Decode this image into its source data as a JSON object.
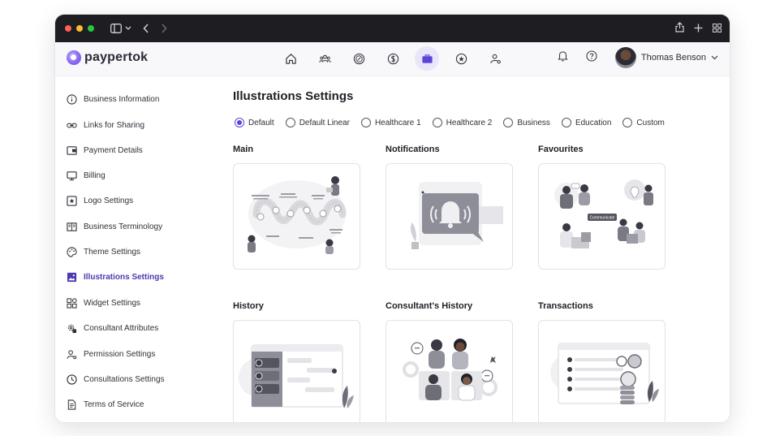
{
  "app": {
    "logo_text": "paypertok",
    "brand_color": "#6b48e0",
    "accent_color": "#5a44d6"
  },
  "titlebar": {
    "icons": [
      "sidebar-icon",
      "chevron-down-icon",
      "back-icon",
      "forward-icon",
      "share-icon",
      "plus-icon",
      "grid-icon"
    ]
  },
  "nav": {
    "items": [
      {
        "name": "home-icon"
      },
      {
        "name": "people-icon"
      },
      {
        "name": "percent-icon"
      },
      {
        "name": "currency-icon"
      },
      {
        "name": "briefcase-icon",
        "active": true
      },
      {
        "name": "star-icon"
      },
      {
        "name": "user-settings-icon"
      }
    ]
  },
  "user": {
    "name": "Thomas Benson"
  },
  "sidebar": {
    "items": [
      {
        "label": "Business Information",
        "icon": "info-icon"
      },
      {
        "label": "Links for Sharing",
        "icon": "link-icon"
      },
      {
        "label": "Payment Details",
        "icon": "wallet-icon"
      },
      {
        "label": "Billing",
        "icon": "monitor-icon"
      },
      {
        "label": "Logo Settings",
        "icon": "star-box-icon"
      },
      {
        "label": "Business Terminology",
        "icon": "book-icon"
      },
      {
        "label": "Theme Settings",
        "icon": "palette-icon"
      },
      {
        "label": "Illustrations Settings",
        "icon": "image-icon",
        "active": true
      },
      {
        "label": "Widget Settings",
        "icon": "widgets-icon"
      },
      {
        "label": "Consultant Attributes",
        "icon": "gear-user-icon"
      },
      {
        "label": "Permission Settings",
        "icon": "user-key-icon"
      },
      {
        "label": "Consultations Settings",
        "icon": "clock-icon"
      },
      {
        "label": "Terms of Service",
        "icon": "document-icon"
      }
    ]
  },
  "main": {
    "title": "Illustrations Settings",
    "options": [
      "Default",
      "Default Linear",
      "Healthcare 1",
      "Healthcare 2",
      "Business",
      "Education",
      "Custom"
    ],
    "selected_option": "Default",
    "sections": [
      {
        "title": "Main"
      },
      {
        "title": "Notifications"
      },
      {
        "title": "Favourites",
        "badge": "Communicate"
      },
      {
        "title": "History"
      },
      {
        "title": "Consultant's History"
      },
      {
        "title": "Transactions"
      }
    ]
  }
}
